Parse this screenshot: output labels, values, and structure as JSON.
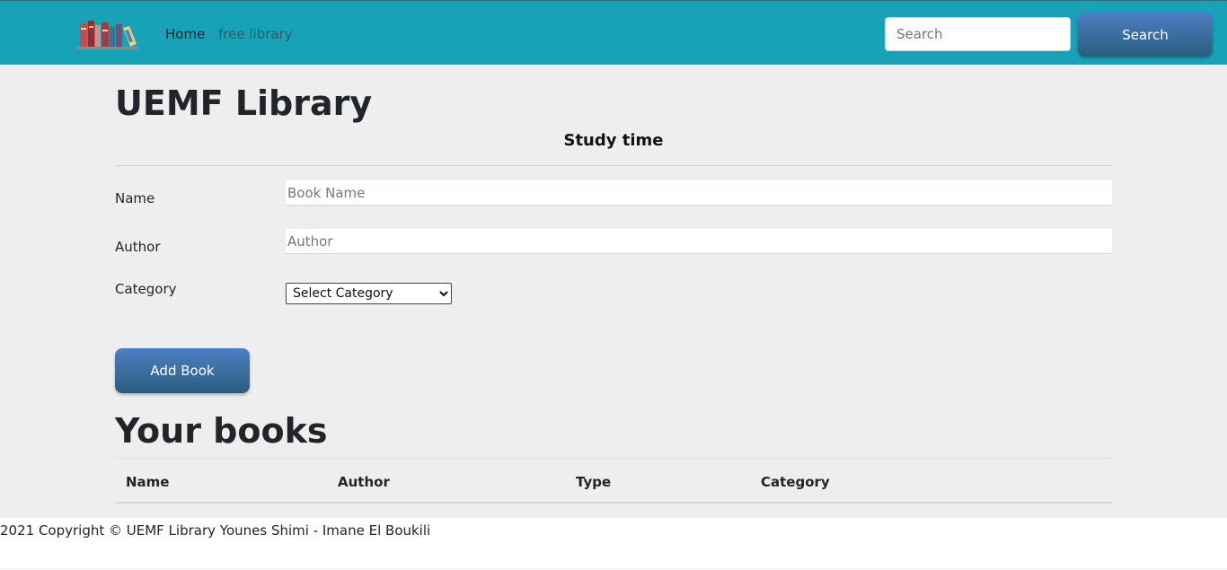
{
  "navbar": {
    "logo_icon": "books-logo-icon",
    "links": [
      "Home",
      "free library"
    ],
    "search_placeholder": "Search",
    "search_button": "Search",
    "colors": {
      "background": "#17a2b8",
      "button_top": "#4d7fc4",
      "button_bottom": "#2a5d7e"
    }
  },
  "main": {
    "title": "UEMF Library",
    "subtitle": "Study time",
    "form": {
      "name_label": "Name",
      "name_placeholder": "Book Name",
      "author_label": "Author",
      "author_placeholder": "Author",
      "category_label": "Category",
      "category_selected": "Select Category",
      "submit_label": "Add Book"
    },
    "books": {
      "title": "Your books",
      "columns": [
        "Name",
        "Author",
        "Type",
        "Category"
      ],
      "rows": []
    }
  },
  "footer": {
    "text": "2021 Copyright © UEMF Library Younes Shimi - Imane El Boukili"
  }
}
